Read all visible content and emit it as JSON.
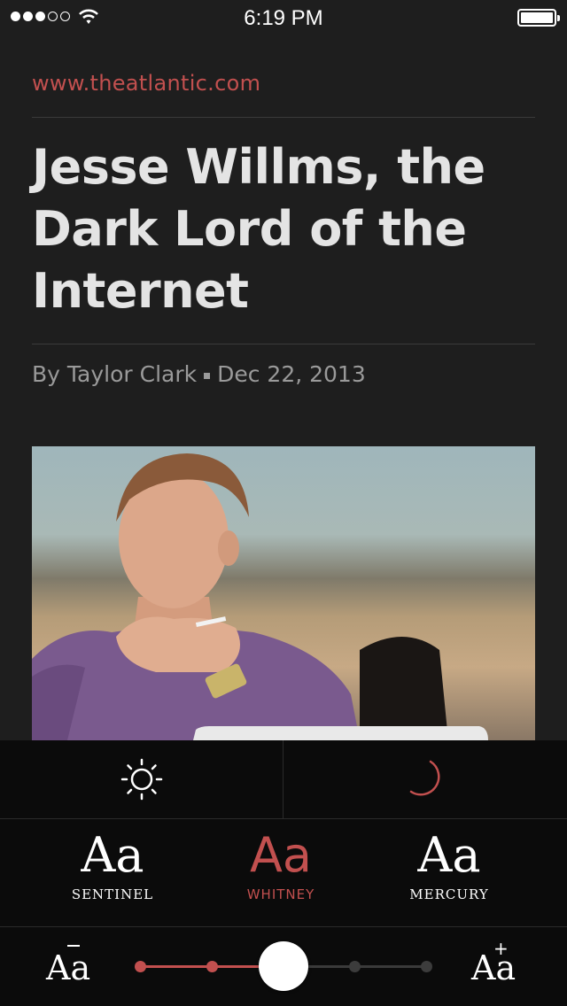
{
  "status_bar": {
    "signal_filled": 3,
    "signal_total": 5,
    "time": "6:19 PM",
    "battery_level": 1.0
  },
  "article": {
    "source_url": "www.theatlantic.com",
    "title": "Jesse Willms, the Dark Lord of the Internet",
    "author": "By Taylor Clark",
    "date": "Dec 22, 2013",
    "image_icon": "photo-of-man-at-laptop"
  },
  "settings": {
    "themes": [
      {
        "name": "day",
        "icon": "sun-icon",
        "selected": false
      },
      {
        "name": "night",
        "icon": "moon-icon",
        "selected": true
      }
    ],
    "fonts": [
      {
        "sample": "Aa",
        "name": "SENTINEL",
        "selected": false
      },
      {
        "sample": "Aa",
        "name": "WHITNEY",
        "selected": true
      },
      {
        "sample": "Aa",
        "name": "MERCURY",
        "selected": false
      }
    ],
    "text_size": {
      "decrease_label": "Aa",
      "increase_label": "Aa",
      "steps": 5,
      "current_step": 3
    }
  },
  "colors": {
    "accent": "#c2504f",
    "background": "#1e1e1e",
    "panel": "#0b0b0b"
  }
}
